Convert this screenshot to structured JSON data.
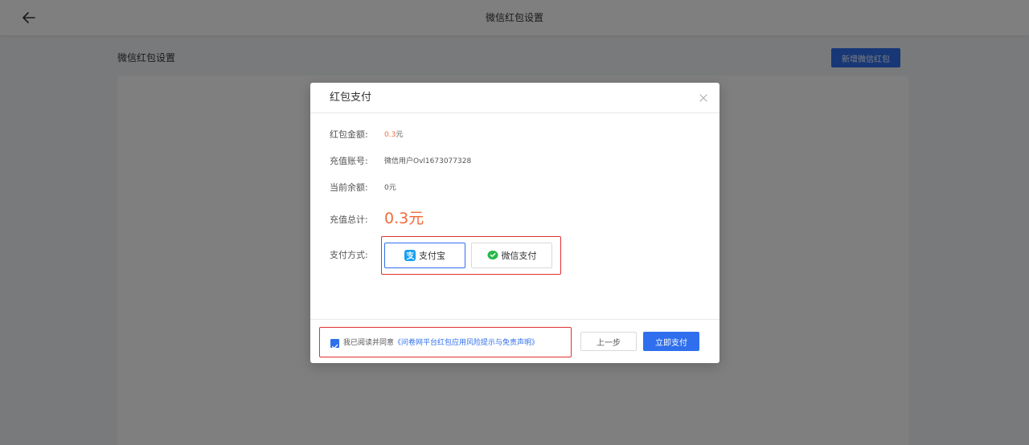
{
  "topbar": {
    "title": "微信红包设置",
    "back_icon": "arrow-left-icon"
  },
  "content": {
    "title": "微信红包设置",
    "new_button_label": "新增微信红包"
  },
  "modal": {
    "title": "红包支付",
    "close_icon": "close-icon",
    "rows": {
      "amount_label": "红包金额:",
      "amount_value": "0.3",
      "amount_unit": "元",
      "account_label": "充值账号:",
      "account_value": "微信用户Ovl1673077328",
      "balance_label": "当前余额:",
      "balance_value": "0元",
      "total_label": "充值总计:",
      "total_value": "0.3元",
      "method_label": "支付方式:"
    },
    "payment_methods": {
      "alipay": {
        "label": "支付宝",
        "icon": "alipay-icon",
        "selected": true
      },
      "wechat": {
        "label": "微信支付",
        "icon": "wechat-pay-icon",
        "selected": false
      }
    },
    "footer": {
      "agree_checked": true,
      "agree_prefix": "我已阅读并同意",
      "agree_link": "《问卷网平台红包应用风险提示与免责声明》",
      "prev_button": "上一步",
      "pay_button": "立即支付"
    }
  },
  "colors": {
    "accent": "#2f6fed",
    "highlight": "#f26b3a",
    "annotation_border": "#e23030"
  }
}
